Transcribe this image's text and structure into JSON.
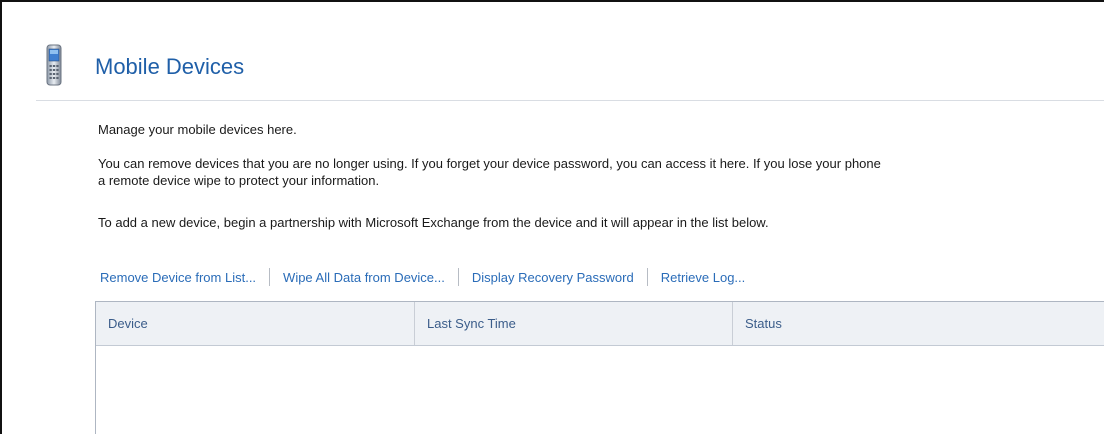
{
  "header": {
    "title": "Mobile Devices",
    "icon": "mobile-phone-icon"
  },
  "intro": {
    "line1": "Manage your mobile devices here.",
    "line2": "You can remove devices that you are no longer using. If you forget your device password, you can access it here. If you lose your phone",
    "line2b": "a remote device wipe to protect your information.",
    "line3": "To add a new device, begin a partnership with Microsoft Exchange from the device and it will appear in the list below."
  },
  "toolbar": {
    "remove_label": "Remove Device from List...",
    "wipe_label": "Wipe All Data from Device...",
    "recovery_label": "Display Recovery Password",
    "log_label": "Retrieve Log..."
  },
  "devices_table": {
    "columns": [
      "Device",
      "Last Sync Time",
      "Status"
    ],
    "rows": []
  },
  "colors": {
    "title": "#1f5fa8",
    "link": "#2a6cb8",
    "header_bg": "#eef1f5"
  }
}
